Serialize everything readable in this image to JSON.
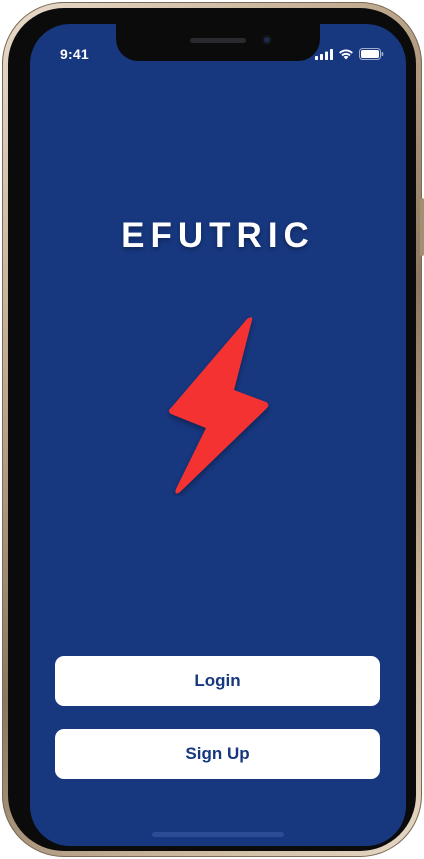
{
  "status_bar": {
    "time": "9:41"
  },
  "splash": {
    "brand_name": "EFUTRIC",
    "logo_icon": "lightning-bolt-icon",
    "colors": {
      "background": "#17377f",
      "bolt": "#f53333",
      "button_background": "#ffffff",
      "button_text": "#17377f"
    }
  },
  "actions": {
    "login_label": "Login",
    "signup_label": "Sign Up"
  }
}
